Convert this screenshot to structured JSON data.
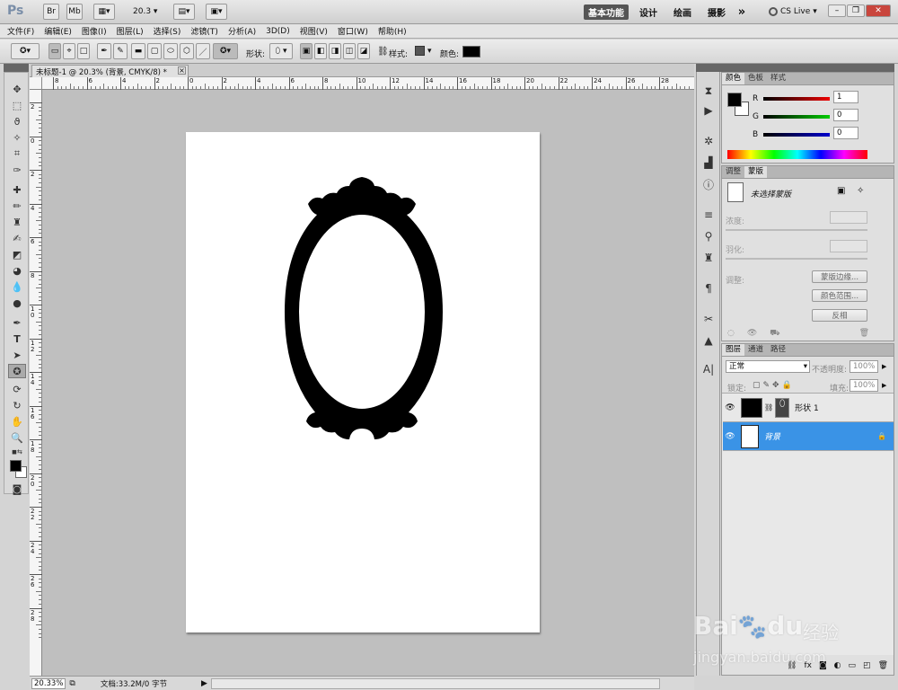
{
  "app": {
    "logo": "Ps",
    "br": "Br",
    "mb": "Mb",
    "zoom": "20.3",
    "workspaces": [
      "基本功能",
      "设计",
      "绘画",
      "摄影"
    ],
    "more": "»",
    "cslive": "CS Live"
  },
  "menu": [
    "文件(F)",
    "编辑(E)",
    "图像(I)",
    "图层(L)",
    "选择(S)",
    "滤镜(T)",
    "分析(A)",
    "3D(D)",
    "视图(V)",
    "窗口(W)",
    "帮助(H)"
  ],
  "options": {
    "shape_label": "形状:",
    "style_label": "样式:",
    "color_label": "颜色:",
    "color": "#000000"
  },
  "document": {
    "tab_title": "未标题-1 @ 20.3% (背景, CMYK/8) *",
    "close": "×"
  },
  "ruler": {
    "h_ticks": [
      "8",
      "6",
      "4",
      "2",
      "0",
      "2",
      "4",
      "6",
      "8",
      "10",
      "12",
      "14",
      "16",
      "18",
      "20",
      "22",
      "24",
      "26",
      "28"
    ],
    "v_ticks": [
      "2",
      "0",
      "2",
      "4",
      "6",
      "8",
      "1 0",
      "1 2",
      "1 4",
      "1 6",
      "1 8",
      "2 0",
      "2 2",
      "2 4",
      "2 6",
      "2 8"
    ]
  },
  "status": {
    "zoom": "20.33%",
    "doc": "文档:33.2M/0 字节"
  },
  "color_panel": {
    "tabs": [
      "颜色",
      "色板",
      "样式"
    ],
    "r_label": "R",
    "g_label": "G",
    "b_label": "B",
    "r": "1",
    "g": "0",
    "b": "0"
  },
  "mask_panel": {
    "tabs": [
      "调整",
      "蒙版"
    ],
    "title": "未选择蒙版",
    "density": "浓度:",
    "feather": "羽化:",
    "refine": "调整:",
    "btn_edge": "蒙版边缘...",
    "btn_range": "颜色范围...",
    "btn_invert": "反相"
  },
  "layers_panel": {
    "tabs": [
      "图层",
      "通道",
      "路径"
    ],
    "blend": "正常",
    "opacity_label": "不透明度:",
    "opacity": "100%",
    "lock_label": "锁定:",
    "fill_label": "填充:",
    "fill": "100%",
    "layers": [
      {
        "name": "形状 1"
      },
      {
        "name": "背景"
      }
    ],
    "selected": "#3a93e6"
  },
  "watermark": {
    "brand": "Bai",
    "brand2": "du",
    "suffix": "经验",
    "url": "jingyan.baidu.com"
  }
}
